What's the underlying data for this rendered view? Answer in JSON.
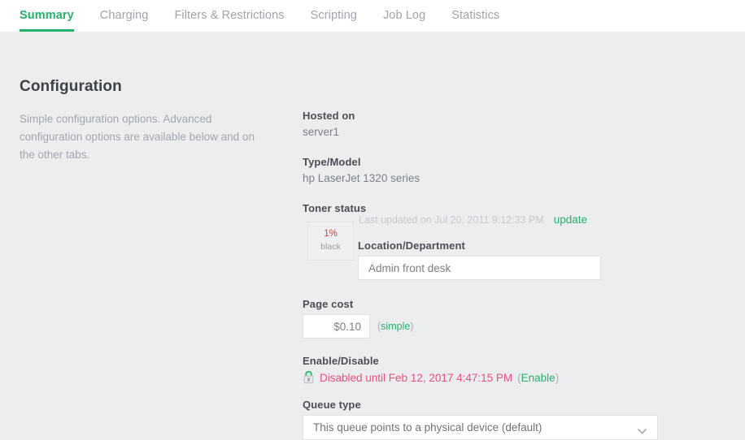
{
  "tabs": [
    {
      "label": "Summary",
      "active": true
    },
    {
      "label": "Charging",
      "active": false
    },
    {
      "label": "Filters & Restrictions",
      "active": false
    },
    {
      "label": "Scripting",
      "active": false
    },
    {
      "label": "Job Log",
      "active": false
    },
    {
      "label": "Statistics",
      "active": false
    }
  ],
  "left": {
    "title": "Configuration",
    "description": "Simple configuration options. Advanced configuration options are available below and on the other tabs."
  },
  "fields": {
    "hosted_on": {
      "label": "Hosted on",
      "value": "server1"
    },
    "type_model": {
      "label": "Type/Model",
      "value": "hp LaserJet 1320 series"
    },
    "toner": {
      "label": "Toner status",
      "percent": "1%",
      "color_name": "black",
      "last_updated": "Last updated on Jul 20, 2011 9:12:33 PM",
      "update_link": "update"
    },
    "location": {
      "label": "Location/Department",
      "value": "Admin front desk",
      "placeholder": ""
    },
    "page_cost": {
      "label": "Page cost",
      "value": "$0.10",
      "note_open": "(",
      "note_link": "simple",
      "note_close": ")"
    },
    "enable_disable": {
      "label": "Enable/Disable",
      "status_text": "Disabled until Feb 12, 2017 4:47:15 PM",
      "action_open": "(",
      "action_link": "Enable",
      "action_close": ")"
    },
    "queue_type": {
      "label": "Queue type",
      "selected": "This queue points to a physical device (default)"
    }
  },
  "colors": {
    "accent_green": "#2bb06c",
    "danger_pink": "#ee4f7e",
    "toner_red": "#d93b3b",
    "page_background": "#ecedef",
    "header_background": "#ffffff"
  }
}
